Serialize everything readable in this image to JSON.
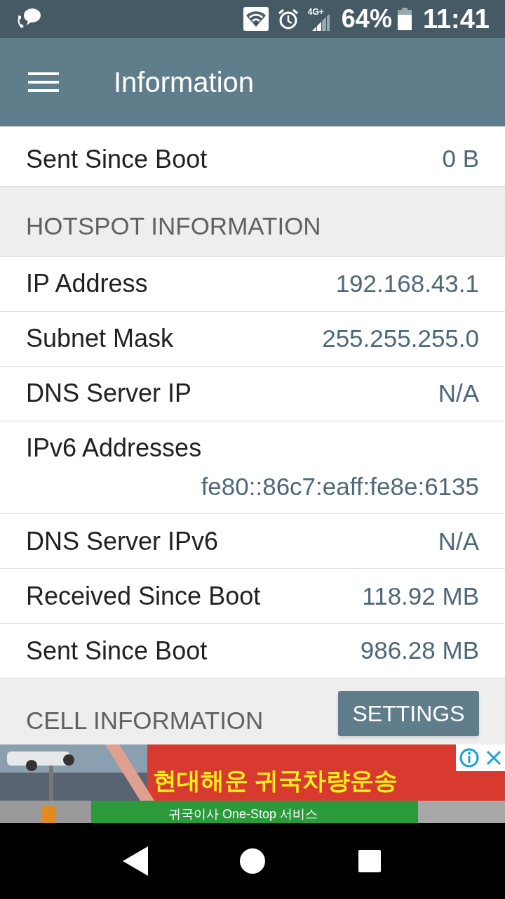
{
  "status_bar": {
    "network": "4G+",
    "battery": "64%",
    "time": "11:41"
  },
  "app_bar": {
    "title": "Information"
  },
  "top_rows": [
    {
      "label": "Sent Since Boot",
      "value": "0 B"
    }
  ],
  "hotspot": {
    "title": "HOTSPOT INFORMATION",
    "rows": [
      {
        "label": "IP Address",
        "value": "192.168.43.1",
        "kind": "inline"
      },
      {
        "label": "Subnet Mask",
        "value": "255.255.255.0",
        "kind": "inline"
      },
      {
        "label": "DNS Server IP",
        "value": "N/A",
        "kind": "inline"
      },
      {
        "label": "IPv6 Addresses",
        "value": "fe80::86c7:eaff:fe8e:6135",
        "kind": "stacked"
      },
      {
        "label": "DNS Server IPv6",
        "value": "N/A",
        "kind": "inline"
      },
      {
        "label": "Received Since Boot",
        "value": "118.92 MB",
        "kind": "inline"
      },
      {
        "label": "Sent Since Boot",
        "value": "986.28 MB",
        "kind": "inline"
      }
    ]
  },
  "cell": {
    "title": "CELL INFORMATION"
  },
  "settings_button": "SETTINGS",
  "ad": {
    "headline": "현대해운 귀국차량운송",
    "tagline": "귀국이사 One-Stop 서비스"
  }
}
